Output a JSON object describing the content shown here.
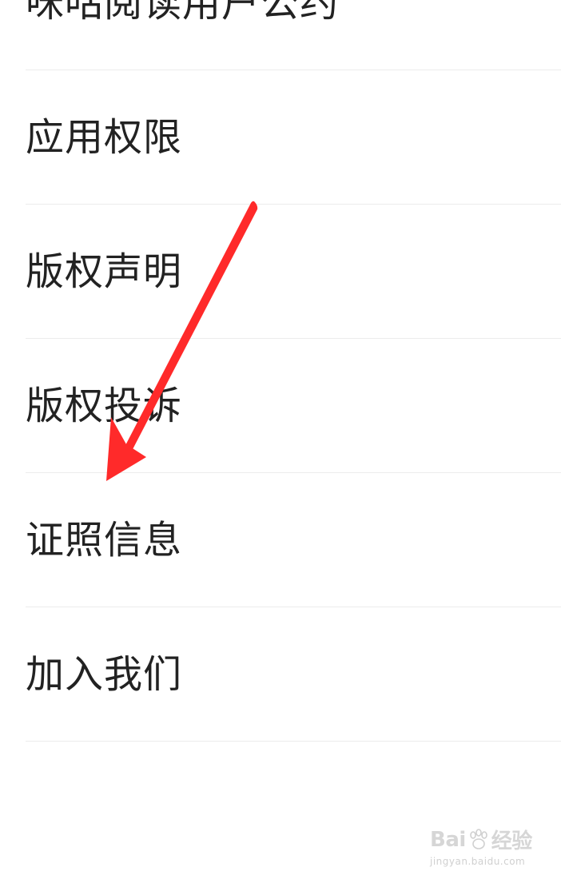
{
  "menu": {
    "items": [
      {
        "label": "咪咕阅读用户公约"
      },
      {
        "label": "应用权限"
      },
      {
        "label": "版权声明"
      },
      {
        "label": "版权投诉"
      },
      {
        "label": "证照信息"
      },
      {
        "label": "加入我们"
      }
    ]
  },
  "annotation": {
    "arrow_color": "#ff2a2a"
  },
  "watermark": {
    "brand_left": "Bai",
    "brand_right": "经验",
    "url": "jingyan.baidu.com"
  }
}
